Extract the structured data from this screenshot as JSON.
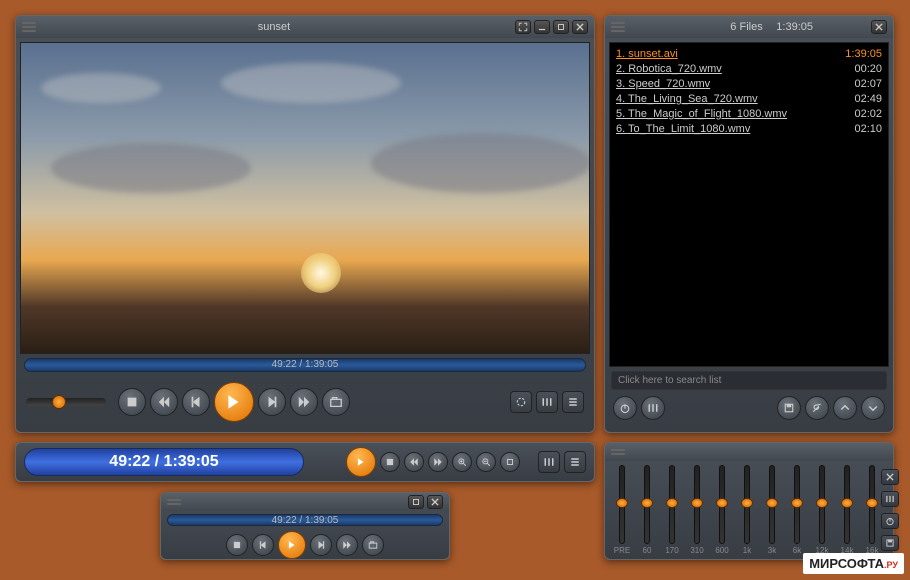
{
  "player": {
    "title": "sunset",
    "seek_label": "49:22 / 1:39:05"
  },
  "playlist": {
    "title": "6 Files",
    "total_time": "1:39:05",
    "search_placeholder": "Click here to search list",
    "items": [
      {
        "name": "1. sunset.avi",
        "dur": "1:39:05",
        "active": true
      },
      {
        "name": "2. Robotica_720.wmv",
        "dur": "00:20",
        "active": false
      },
      {
        "name": "3. Speed_720.wmv",
        "dur": "02:07",
        "active": false
      },
      {
        "name": "4. The_Living_Sea_720.wmv",
        "dur": "02:49",
        "active": false
      },
      {
        "name": "5. The_Magic_of_Flight_1080.wmv",
        "dur": "02:02",
        "active": false
      },
      {
        "name": "6. To_The_Limit_1080.wmv",
        "dur": "02:10",
        "active": false
      }
    ]
  },
  "timebar": {
    "time_text": "49:22 / 1:39:05"
  },
  "mini": {
    "seek_label": "49:22 / 1:39:05"
  },
  "eq": {
    "bands": [
      "PRE",
      "60",
      "170",
      "310",
      "600",
      "1k",
      "3k",
      "6k",
      "12k",
      "14k",
      "16k"
    ]
  },
  "watermark": {
    "text": "МИРСОФТА",
    "suffix": ".РУ"
  }
}
